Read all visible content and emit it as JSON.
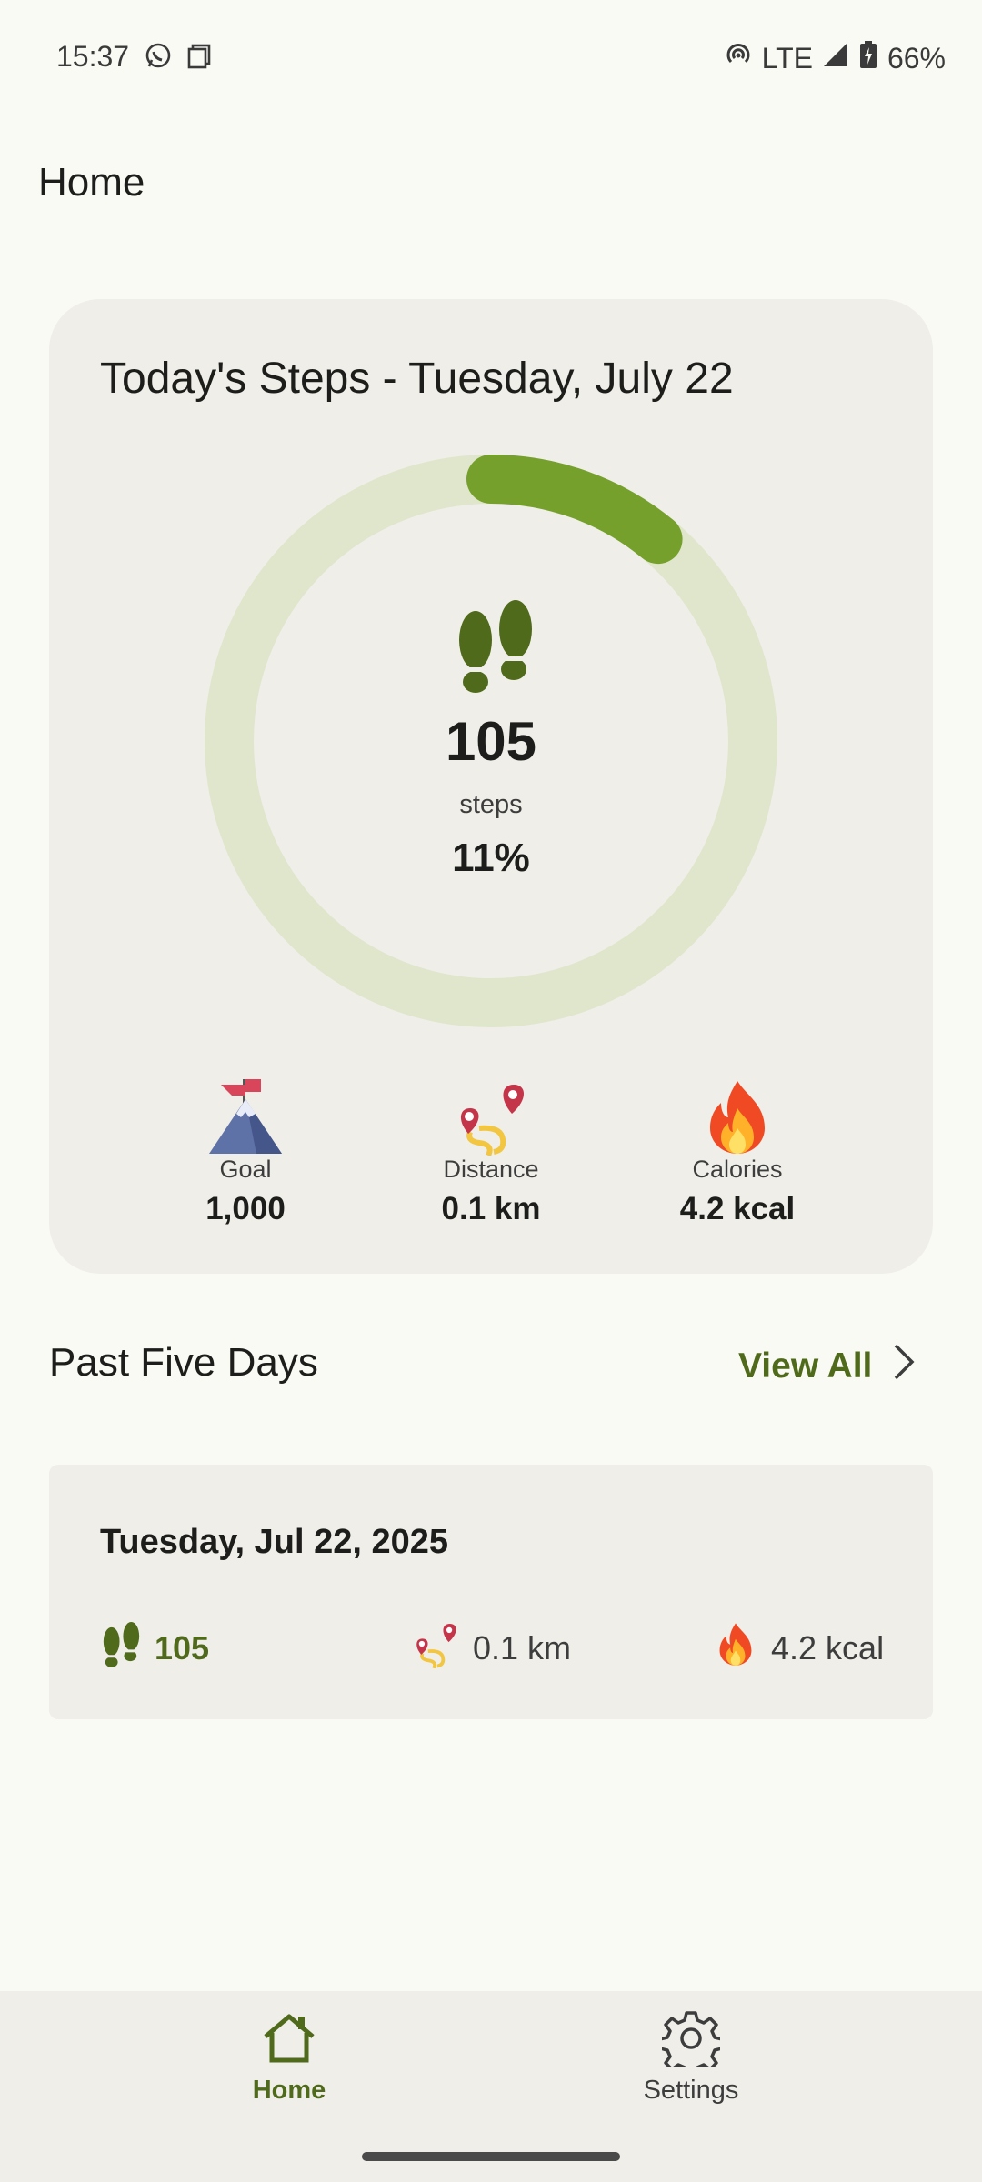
{
  "status_bar": {
    "time": "15:37",
    "network": "LTE",
    "battery": "66%"
  },
  "page": {
    "title": "Home"
  },
  "today_card": {
    "title": "Today's Steps - Tuesday, July 22",
    "steps": "105",
    "steps_unit": "steps",
    "percent": "11%",
    "progress_fraction": 0.11,
    "stats": {
      "goal": {
        "label": "Goal",
        "value": "1,000"
      },
      "distance": {
        "label": "Distance",
        "value": "0.1 km"
      },
      "calories": {
        "label": "Calories",
        "value": "4.2 kcal"
      }
    }
  },
  "past_days": {
    "title": "Past Five Days",
    "view_all": "View All",
    "entries": [
      {
        "date": "Tuesday, Jul 22, 2025",
        "steps": "105",
        "distance": "0.1 km",
        "calories": "4.2 kcal"
      }
    ]
  },
  "bottom_nav": {
    "home": "Home",
    "settings": "Settings"
  },
  "colors": {
    "accent": "#4f6a1b",
    "ring_track": "#dfe6cc",
    "ring_progress": "#75a02c",
    "card": "#efeee8",
    "background": "#fafaf4"
  }
}
